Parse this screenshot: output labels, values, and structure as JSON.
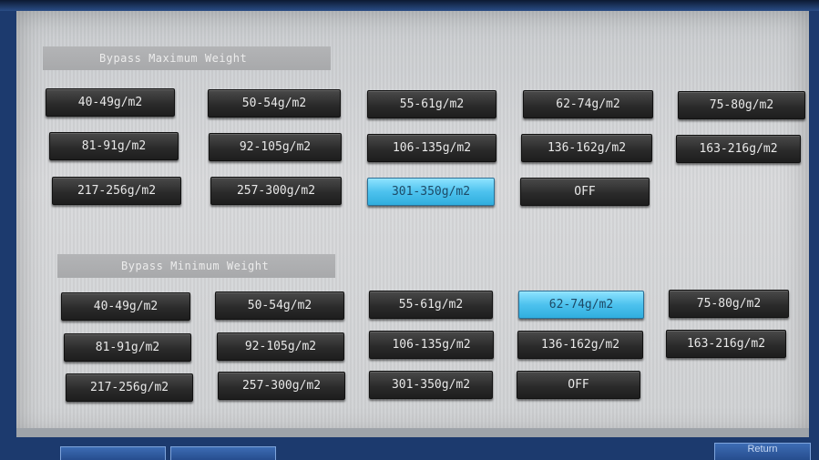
{
  "max_section": {
    "title": "Bypass Maximum Weight",
    "buttons": [
      {
        "label": "40-49g/m2",
        "selected": false
      },
      {
        "label": "50-54g/m2",
        "selected": false
      },
      {
        "label": "55-61g/m2",
        "selected": false
      },
      {
        "label": "62-74g/m2",
        "selected": false
      },
      {
        "label": "75-80g/m2",
        "selected": false
      },
      {
        "label": "81-91g/m2",
        "selected": false
      },
      {
        "label": "92-105g/m2",
        "selected": false
      },
      {
        "label": "106-135g/m2",
        "selected": false
      },
      {
        "label": "136-162g/m2",
        "selected": false
      },
      {
        "label": "163-216g/m2",
        "selected": false
      },
      {
        "label": "217-256g/m2",
        "selected": false
      },
      {
        "label": "257-300g/m2",
        "selected": false
      },
      {
        "label": "301-350g/m2",
        "selected": true
      },
      {
        "label": "OFF",
        "selected": false
      }
    ]
  },
  "min_section": {
    "title": "Bypass Minimum Weight",
    "buttons": [
      {
        "label": "40-49g/m2",
        "selected": false
      },
      {
        "label": "50-54g/m2",
        "selected": false
      },
      {
        "label": "55-61g/m2",
        "selected": false
      },
      {
        "label": "62-74g/m2",
        "selected": true
      },
      {
        "label": "75-80g/m2",
        "selected": false
      },
      {
        "label": "81-91g/m2",
        "selected": false
      },
      {
        "label": "92-105g/m2",
        "selected": false
      },
      {
        "label": "106-135g/m2",
        "selected": false
      },
      {
        "label": "136-162g/m2",
        "selected": false
      },
      {
        "label": "163-216g/m2",
        "selected": false
      },
      {
        "label": "217-256g/m2",
        "selected": false
      },
      {
        "label": "257-300g/m2",
        "selected": false
      },
      {
        "label": "301-350g/m2",
        "selected": false
      },
      {
        "label": "OFF",
        "selected": false
      }
    ]
  },
  "footer": {
    "return_label": "Return"
  },
  "colors": {
    "selected_button": "#4dc2ee",
    "button": "#2b2b2b",
    "panel": "#d3d5d7",
    "frame": "#1c3a6e"
  }
}
